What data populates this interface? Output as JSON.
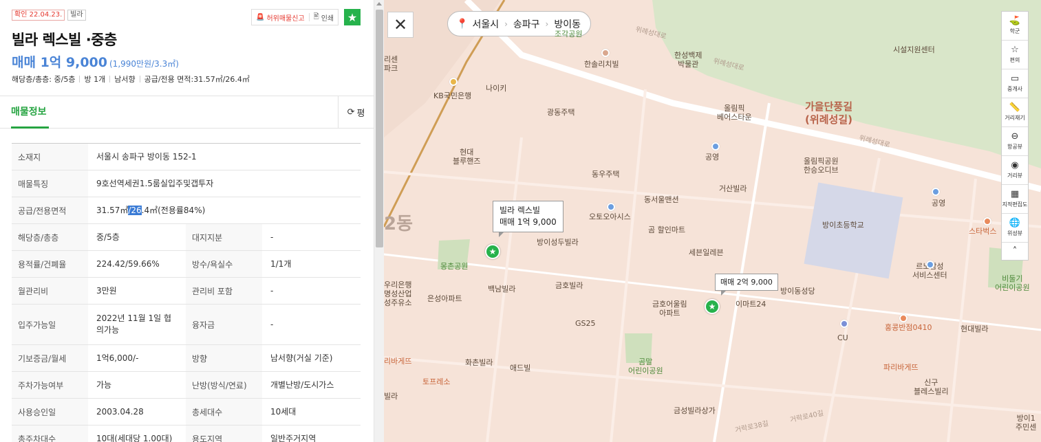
{
  "listing": {
    "confirm_badge": "확인 22.04.23.",
    "type_badge": "빌라",
    "report_label": "허위매물신고",
    "print_label": "인쇄",
    "title": "빌라 렉스빌 ·중층",
    "price_main": "매매 1억 9,000",
    "price_unit": "(1,990만원/3.3㎡)",
    "summary": [
      "해당층/총층: 중/5층",
      "방 1개",
      "남서향",
      "공급/전용 면적:31.57㎡/26.4㎡"
    ]
  },
  "tabs": {
    "info": "매물정보",
    "review": "평"
  },
  "info_table": {
    "address_label": "소재지",
    "address": "서울시 송파구 방이동 152-1",
    "features_label": "매물특징",
    "features": "9호선역세권1.5룸실입주및갭투자",
    "area_label": "공급/전용면적",
    "area_pre": "31.57㎡",
    "area_hl": "/26",
    "area_post": ".4㎡(전용률84%)",
    "floor_label": "해당층/총층",
    "floor": "중/5층",
    "land_label": "대지지분",
    "land": "-",
    "ratio_label": "용적률/건폐율",
    "ratio": "224.42/59.66%",
    "rooms_label": "방수/욕실수",
    "rooms": "1/1개",
    "fee_label": "월관리비",
    "fee": "3만원",
    "fee_incl_label": "관리비 포함",
    "fee_incl": "-",
    "movein_label": "입주가능일",
    "movein": "2022년 11월 1일 협의가능",
    "loan_label": "융자금",
    "loan": "-",
    "deposit_label": "기보증금/월세",
    "deposit": "1억6,000/-",
    "direction_label": "방향",
    "direction": "남서향(거실 기준)",
    "parking_label": "주차가능여부",
    "parking": "가능",
    "heating_label": "난방(방식/연료)",
    "heating": "개별난방/도시가스",
    "approval_label": "사용승인일",
    "approval": "2003.04.28",
    "households_label": "총세대수",
    "households": "10세대",
    "parking_total_label": "총주차대수",
    "parking_total": "10대(세대당 1.00대)",
    "zone_label": "용도지역",
    "zone": "일반주거지역"
  },
  "map": {
    "region": [
      "서울시",
      "송파구",
      "방이동"
    ],
    "tools": [
      "학군",
      "편의",
      "중개사",
      "거리재기",
      "항공뷰",
      "거리뷰",
      "지적편집도",
      "위성뷰"
    ],
    "bubble1_title": "빌라 렉스빌",
    "bubble1_price": "매매 1억 9,000",
    "bubble2_price": "매매 2억 9,000",
    "labels": {
      "jogak": "조각공원",
      "hansolrich": "한솔리치빌",
      "hanseong": "한성백제\n박물관",
      "facility": "시설지원센터",
      "kb": "KB국민은행",
      "nike": "나이키",
      "gwangdong": "광동주택",
      "olympic": "올림픽\n베어스타운",
      "autumn": "가을단풍길\n(위례성길)",
      "hyundai": "현대\n블루핸즈",
      "dongwoo": "동우주택",
      "gongyoung1": "공영",
      "olympic_hansung": "올림픽공원\n한승오디브",
      "geosan": "거산빌라",
      "dongseoul": "동서울맨션",
      "gongyoung2": "공영",
      "autooasis": "오토오아시스",
      "gom": "곰 할인마트",
      "bangi_school": "방이초등학교",
      "starbucks": "스타벅스",
      "bangiseong": "방이성두빌라",
      "mongchon": "몽촌공원",
      "seven": "세븐일레븐",
      "renault": "르노삼성\n서비스센터",
      "bigi_park": "비둘기\n어린이공원",
      "baeknam": "백남빌라",
      "geumho": "금호빌라",
      "bangi_church": "방이동성당",
      "emart": "이마트24",
      "eunseong": "은성아파트",
      "geumho_apt": "금호어울림\n아파트",
      "gs25": "GS25",
      "hongkong": "홍콩반점0410",
      "cu": "CU",
      "hyundai_villa": "현대빌라",
      "hwachon": "화촌빌라",
      "ad": "애드빌",
      "gommal": "곰말\n어린이공원",
      "paris1": "파리바게뜨",
      "paris2": "파리바게뜨",
      "sinkoo": "신구\n블레스빌리",
      "geumseong": "금성빌라상가",
      "dong_left": "2동",
      "misc1": "리센\n파크",
      "misc2": "우리은행\n명성산업\n성주유소",
      "misc3": "리바게뜨",
      "misc4": "토프레소",
      "misc5": "빌라",
      "road1": "위례성대로",
      "road2": "위례성대로",
      "road3": "위례성대로",
      "road4": "거락로40길",
      "road5": "거락로38길",
      "bangi1": "방이1\n주민센"
    }
  },
  "colors": {
    "accent_green": "#26b24c",
    "price_blue": "#4a84d6",
    "report_red": "#e5362d"
  }
}
